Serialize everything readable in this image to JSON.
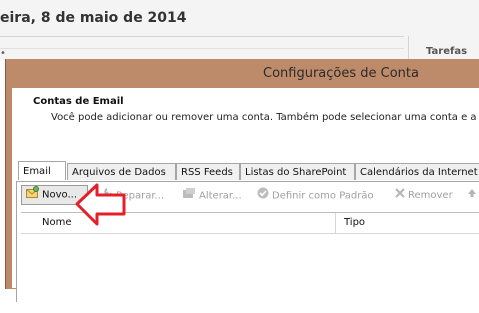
{
  "background": {
    "date_text": "eira, 8 de maio de 2014",
    "tasks_label": "Tarefas",
    "bullet": "•"
  },
  "dialog": {
    "title": "Configurações de Conta",
    "section_title": "Contas de Email",
    "section_description": "Você pode adicionar ou remover uma conta. Também pode selecionar uma conta e a"
  },
  "tabs": [
    {
      "label": "Email",
      "active": true
    },
    {
      "label": "Arquivos de Dados"
    },
    {
      "label": "RSS Feeds"
    },
    {
      "label": "Listas do SharePoint"
    },
    {
      "label": "Calendários da Internet"
    }
  ],
  "toolbar": {
    "new_label": "Novo...",
    "repair_label": "Reparar...",
    "change_label": "Alterar...",
    "default_label": "Definir como Padrão",
    "remove_label": "Remover"
  },
  "list": {
    "columns": [
      "Nome",
      "Tipo"
    ]
  },
  "colors": {
    "dialog_frame": "#be8b6a",
    "arrow": "#e3202a"
  }
}
